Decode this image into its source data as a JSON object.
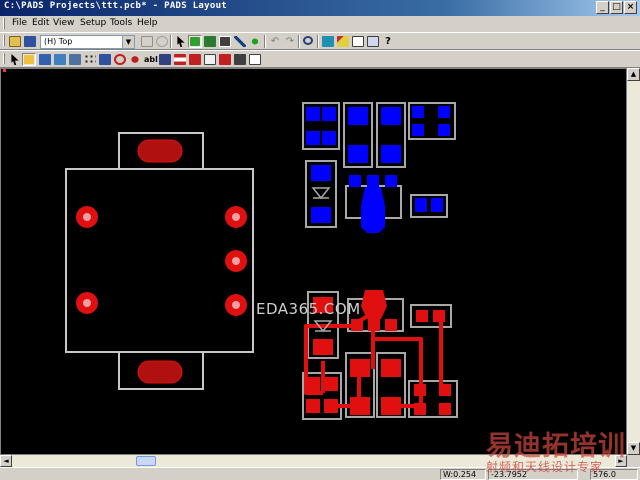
{
  "window": {
    "title": "C:\\PADS Projects\\ttt.pcb* - PADS Layout"
  },
  "window_buttons": {
    "minimize": "_",
    "maximize": "□",
    "close": "×"
  },
  "menu": [
    "File",
    "Edit",
    "View",
    "Setup",
    "Tools",
    "Help"
  ],
  "toolbar1": {
    "layer_select": "(H) Top",
    "icons": [
      "open-icon",
      "save-icon",
      "layer-select",
      "component-icon",
      "refresh-icon",
      "select-icon",
      "select-filter-icon",
      "plane-icon",
      "route-icon",
      "autoroute-icon",
      "undo-icon",
      "redo-icon",
      "zoom-icon",
      "verify-icon",
      "clear-icon",
      "properties-icon",
      "sketch-icon",
      "help-icon"
    ]
  },
  "toolbar2": {
    "icons": [
      "select-arrow-icon",
      "design-toolbar-icon",
      "drafting-toolbar-icon",
      "dimensioning-icon",
      "ecotools-icon",
      "bga-icon",
      "route-editing-icon",
      "autodimension-icon",
      "via-icon",
      "text-icon",
      "length-icon",
      "stackup-icon",
      "pad-icon",
      "drc-icon",
      "cam-icon",
      "library-icon",
      "report-icon",
      "layers-icon"
    ]
  },
  "status": {
    "width": "W:0.254",
    "coords": "-23.7952",
    "extra": "576.0"
  },
  "watermarks": {
    "site": "EDA365.COM",
    "brand": "易迪拓培训",
    "slogan": "射频和天线设计专家"
  },
  "colors": {
    "board_bg": "#000000",
    "outline": "#c8c8c8",
    "top_copper": "#e01010",
    "inner_pad": "#0000ff",
    "drill": "#f0f0f0"
  }
}
